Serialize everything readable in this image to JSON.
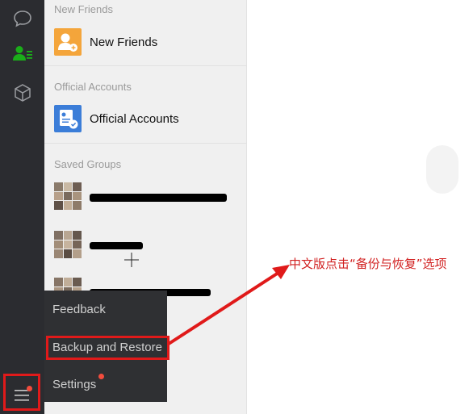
{
  "sidebar": {
    "icons": [
      "chat-icon",
      "contacts-icon",
      "box-icon",
      "menu-icon"
    ]
  },
  "contacts": {
    "sections": {
      "new_friends_title": "New Friends",
      "official_accounts_title": "Official Accounts",
      "saved_groups_title": "Saved Groups"
    },
    "new_friends_label": "New Friends",
    "official_accounts_label": "Official Accounts"
  },
  "menu": {
    "feedback": "Feedback",
    "backup_restore": "Backup and Restore",
    "settings": "Settings"
  },
  "annotation": {
    "text": "中文版点击“备份与恢复”选项"
  },
  "colors": {
    "rail_bg": "#2b2c30",
    "list_bg": "#f0f0f0",
    "accent_green": "#1aad19",
    "new_friends_bg": "#f4a53b",
    "official_bg": "#3b7dd8",
    "highlight_red": "#e01a1a",
    "badge_red": "#f24c3d"
  }
}
